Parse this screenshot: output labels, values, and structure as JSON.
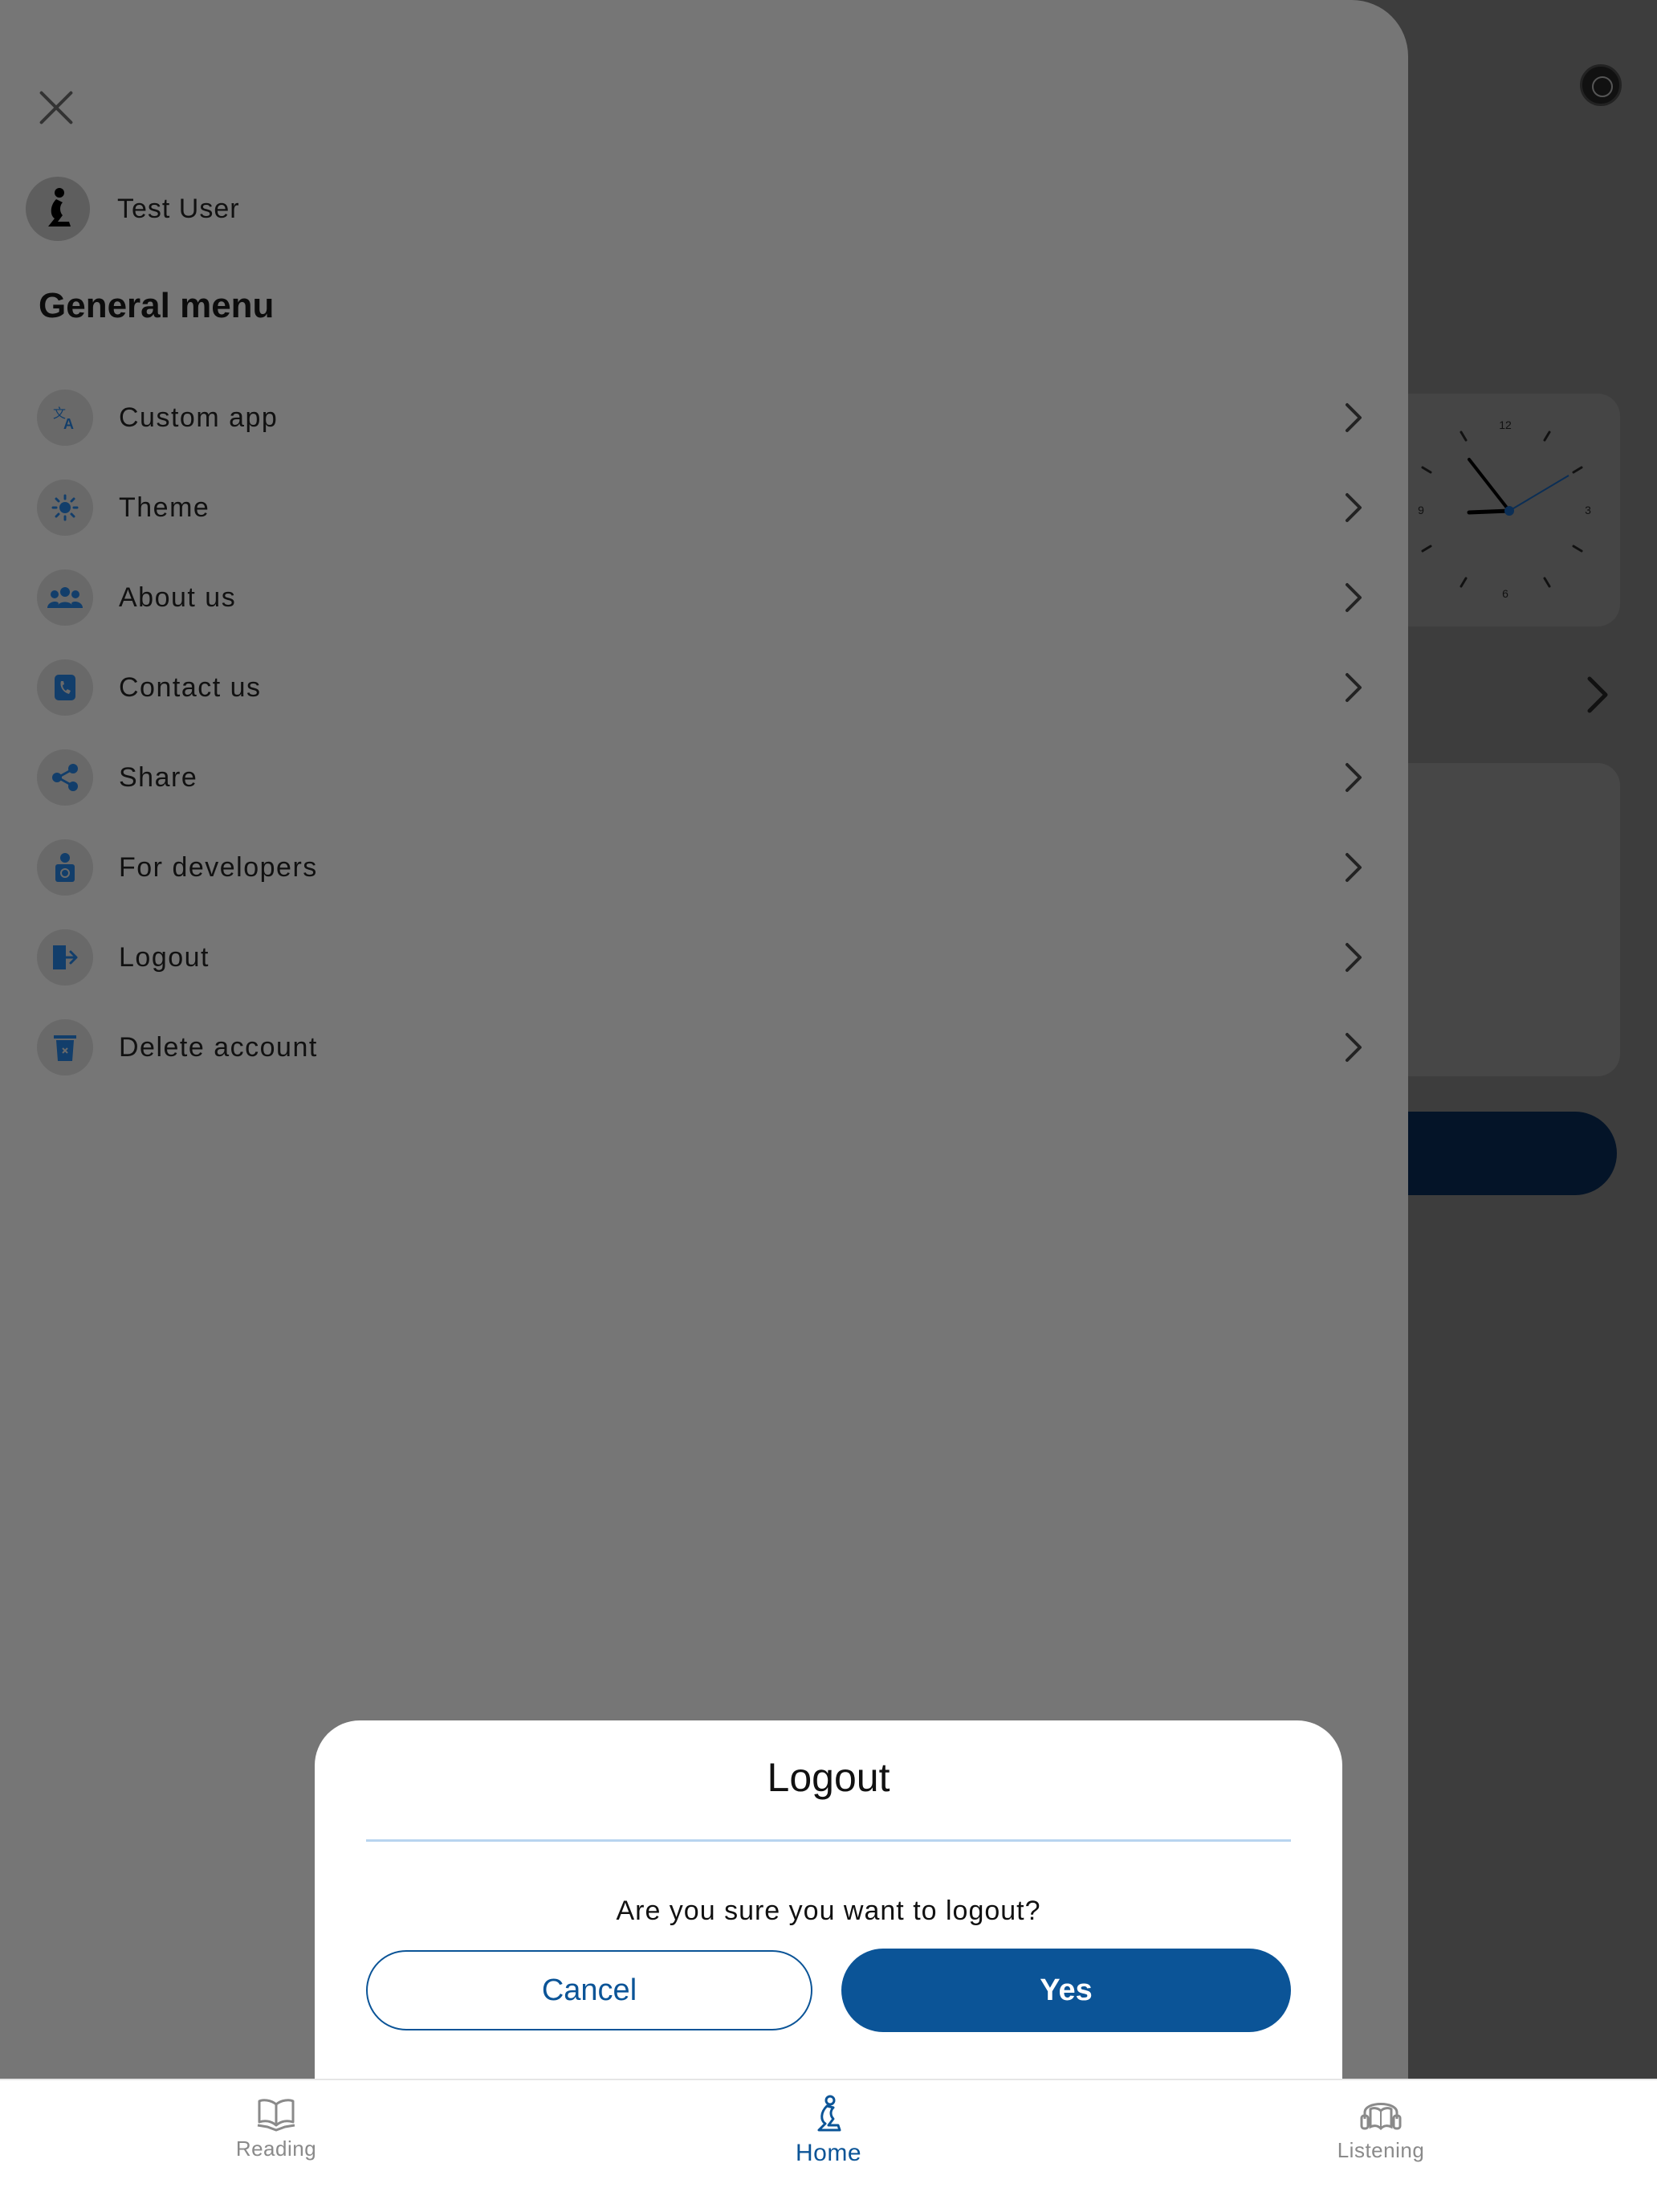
{
  "drawer": {
    "user_name": "Test User",
    "section_title": "General menu",
    "items": [
      {
        "label": "Custom app",
        "icon": "translate-icon"
      },
      {
        "label": "Theme",
        "icon": "sun-icon"
      },
      {
        "label": "About us",
        "icon": "group-icon"
      },
      {
        "label": "Contact us",
        "icon": "phone-icon"
      },
      {
        "label": "Share",
        "icon": "share-icon"
      },
      {
        "label": "For developers",
        "icon": "developer-icon"
      },
      {
        "label": "Logout",
        "icon": "logout-icon"
      },
      {
        "label": "Delete account",
        "icon": "trash-icon"
      }
    ]
  },
  "dialog": {
    "title": "Logout",
    "message": "Are you sure you want to logout?",
    "cancel_label": "Cancel",
    "confirm_label": "Yes"
  },
  "bottom_nav": {
    "items": [
      {
        "label": "Reading",
        "icon": "book-icon",
        "active": false
      },
      {
        "label": "Home",
        "icon": "praying-person-icon",
        "active": true
      },
      {
        "label": "Listening",
        "icon": "headphones-book-icon",
        "active": false
      }
    ]
  },
  "background": {
    "clock_numbers": [
      "12",
      "3",
      "6",
      "9"
    ]
  },
  "colors": {
    "accent": "#0b5497",
    "icon_color": "#123e6b",
    "drawer_bg": "#767676",
    "scrim": "#3d3d3d"
  }
}
